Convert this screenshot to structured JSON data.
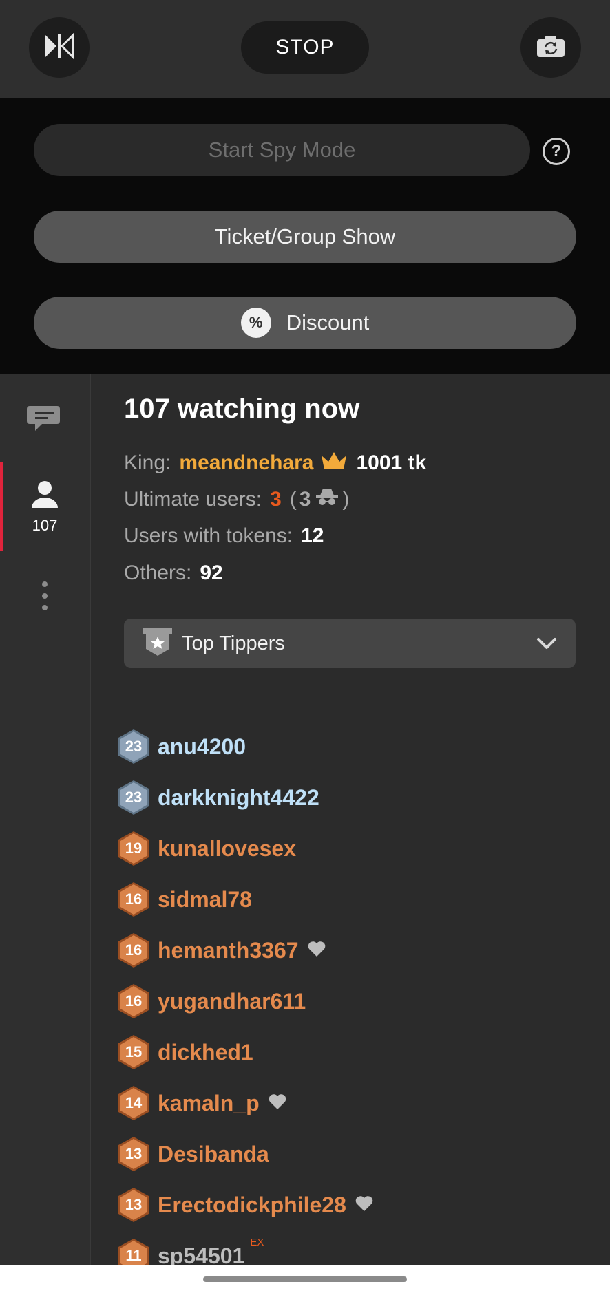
{
  "topbar": {
    "left_icon": "mirror-flip-icon",
    "stop_label": "STOP",
    "right_icon": "camera-switch-icon"
  },
  "controls": {
    "spy_label": "Start Spy Mode",
    "help_icon": "question-icon",
    "ticket_label": "Ticket/Group Show",
    "discount_label": "Discount",
    "discount_icon": "percent-badge-icon"
  },
  "sidebar": {
    "items": [
      {
        "icon": "chat-bubbles-icon"
      },
      {
        "icon": "user-icon",
        "count": "107",
        "active": true
      },
      {
        "icon": "more-vertical-icon"
      }
    ]
  },
  "main": {
    "title": "107 watching now",
    "king_label": "King:",
    "king_name": "meandnehara",
    "king_tokens": "1001 tk",
    "ultimate_label": "Ultimate users:",
    "ultimate_count": "3",
    "ultimate_open": "(",
    "ultimate_spy": "3",
    "ultimate_close": ")",
    "tokens_label": "Users with tokens:",
    "tokens_count": "12",
    "others_label": "Others:",
    "others_count": "92",
    "dropdown_label": "Top Tippers"
  },
  "tippers": [
    {
      "level": "23",
      "name": "anu4200",
      "tier": "silver"
    },
    {
      "level": "23",
      "name": "darkknight4422",
      "tier": "silver"
    },
    {
      "level": "19",
      "name": "kunallovesex",
      "tier": "bronze"
    },
    {
      "level": "16",
      "name": "sidmal78",
      "tier": "bronze"
    },
    {
      "level": "16",
      "name": "hemanth3367",
      "tier": "bronze",
      "heart": true
    },
    {
      "level": "16",
      "name": "yugandhar611",
      "tier": "bronze"
    },
    {
      "level": "15",
      "name": "dickhed1",
      "tier": "bronze"
    },
    {
      "level": "14",
      "name": "kamaln_p",
      "tier": "bronze",
      "heart": true
    },
    {
      "level": "13",
      "name": "Desibanda",
      "tier": "bronze"
    },
    {
      "level": "13",
      "name": "Erectodickphile28",
      "tier": "bronze",
      "heart": true
    },
    {
      "level": "11",
      "name": "sp54501",
      "tier": "grey",
      "ex": "EX"
    }
  ],
  "colors": {
    "accent_red": "#e0243c",
    "king_gold": "#f2aa3b",
    "ultimate_orange": "#e85a1e",
    "silver_name": "#bfe0f7",
    "bronze_name": "#e58a4d"
  }
}
